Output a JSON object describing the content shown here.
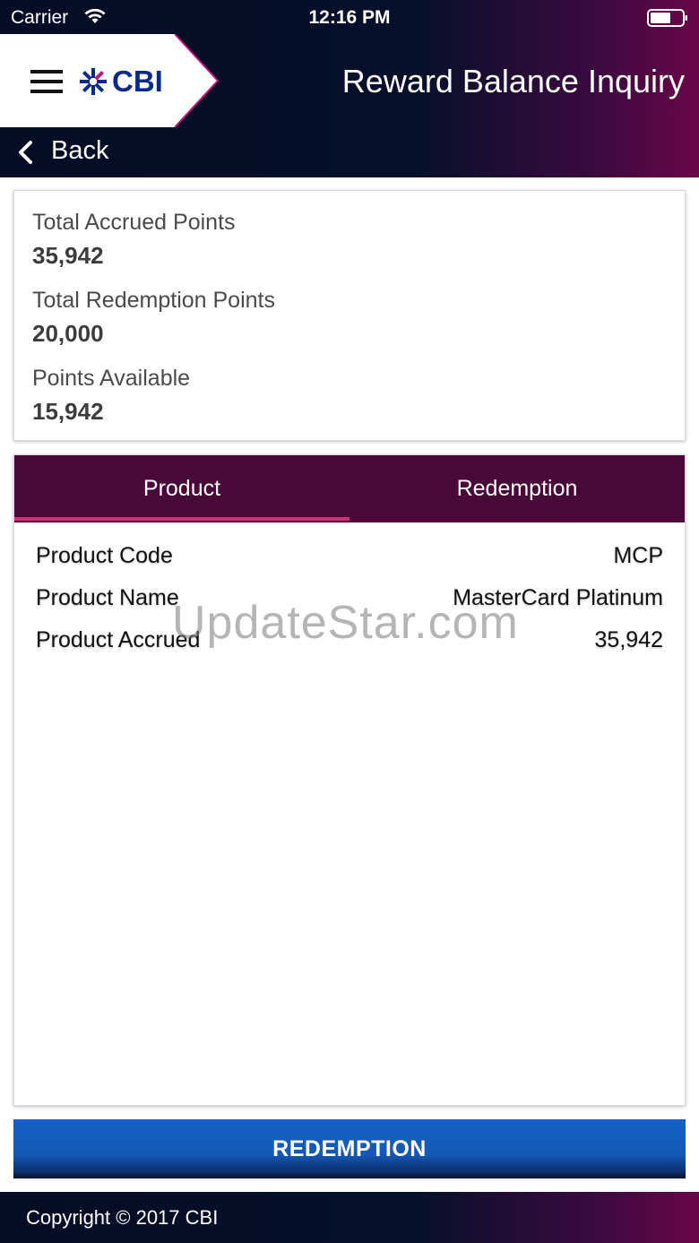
{
  "status_bar": {
    "carrier": "Carrier",
    "time": "12:16 PM",
    "wifi_icon": "wifi-icon",
    "battery_icon": "battery-icon"
  },
  "header": {
    "menu_icon": "hamburger-menu-icon",
    "logo_text": "CBI",
    "title": "Reward Balance Inquiry",
    "back_label": "Back",
    "colors": {
      "navy": "#050c26",
      "magenta": "#6a0648"
    }
  },
  "summary": {
    "items": [
      {
        "label": "Total Accrued Points",
        "value": "35,942"
      },
      {
        "label": "Total Redemption Points",
        "value": "20,000"
      },
      {
        "label": "Points Available",
        "value": "15,942"
      }
    ]
  },
  "tabs": {
    "items": [
      {
        "label": "Product",
        "active": true
      },
      {
        "label": "Redemption",
        "active": false
      }
    ],
    "active_color": "#e0287a",
    "bar_color": "#4a0838"
  },
  "product_details": [
    {
      "label": "Product Code",
      "value": "MCP"
    },
    {
      "label": "Product Name",
      "value": "MasterCard Platinum"
    },
    {
      "label": "Product Accrued",
      "value": "35,942"
    }
  ],
  "watermark": "UpdateStar.com",
  "redemption_button": {
    "label": "REDEMPTION",
    "color": "#1561c4"
  },
  "footer": {
    "text": "Copyright © 2017 CBI"
  }
}
